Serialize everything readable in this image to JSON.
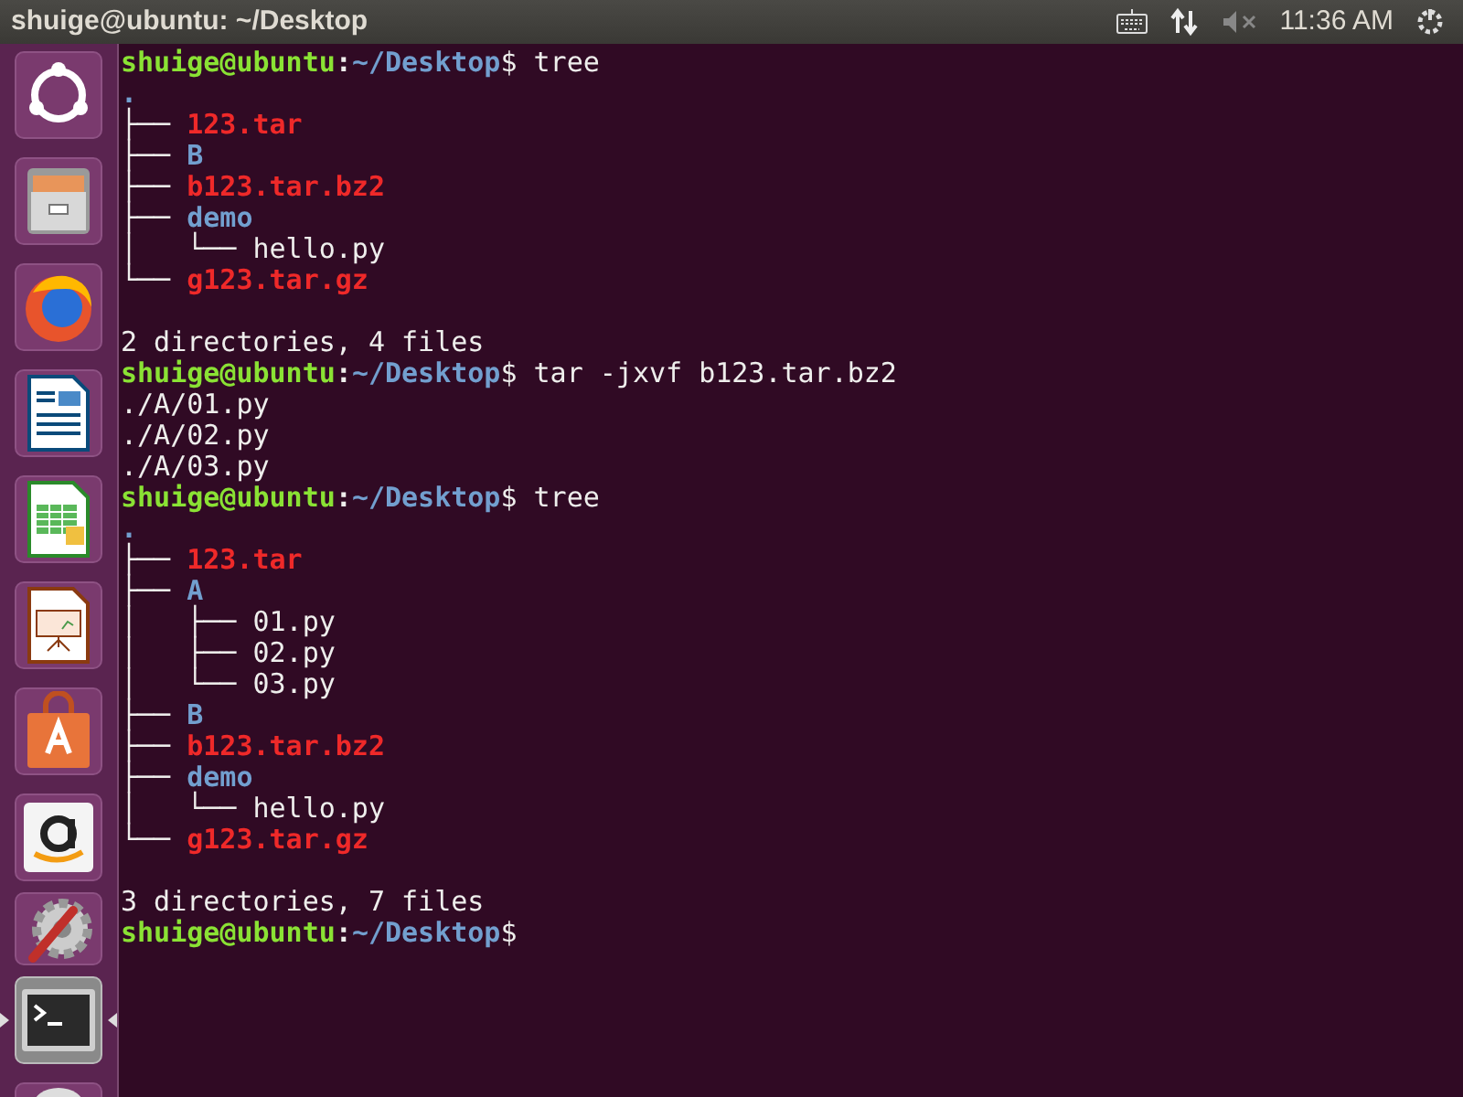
{
  "top_bar": {
    "title": "shuige@ubuntu: ~/Desktop",
    "clock": "11:36 AM"
  },
  "launcher": [
    {
      "kind": "ubuntu",
      "selected": false
    },
    {
      "kind": "files",
      "selected": false
    },
    {
      "kind": "browser",
      "selected": false
    },
    {
      "kind": "writer",
      "selected": false
    },
    {
      "kind": "calc",
      "selected": false
    },
    {
      "kind": "impress",
      "selected": false
    },
    {
      "kind": "store",
      "selected": false
    },
    {
      "kind": "amazon",
      "selected": false
    },
    {
      "kind": "settings",
      "selected": false
    },
    {
      "kind": "terminal",
      "selected": true
    },
    {
      "kind": "disc",
      "selected": false
    }
  ],
  "terminal": {
    "lines": [
      {
        "kind": "prompt",
        "user": "shuige@ubuntu",
        "sep": ":",
        "path": "~/Desktop",
        "symbol": "$",
        "command": " tree"
      },
      {
        "kind": "tree",
        "root": ".",
        "children": [
          {
            "prefix": "├── ",
            "name": "123.tar",
            "kind": "archive"
          },
          {
            "prefix": "├── ",
            "name": "B",
            "kind": "dir"
          },
          {
            "prefix": "├── ",
            "name": "b123.tar.bz2",
            "kind": "archive"
          },
          {
            "prefix": "├── ",
            "name": "demo",
            "kind": "dir",
            "children": [
              {
                "prefix": "│   └── ",
                "name": "hello.py",
                "kind": "file"
              }
            ]
          },
          {
            "prefix": "└── ",
            "name": "g123.tar.gz",
            "kind": "archive"
          }
        ]
      },
      {
        "kind": "blank"
      },
      {
        "kind": "text",
        "text": "2 directories, 4 files"
      },
      {
        "kind": "prompt",
        "user": "shuige@ubuntu",
        "sep": ":",
        "path": "~/Desktop",
        "symbol": "$",
        "command": " tar -jxvf b123.tar.bz2"
      },
      {
        "kind": "text",
        "text": "./A/01.py"
      },
      {
        "kind": "text",
        "text": "./A/02.py"
      },
      {
        "kind": "text",
        "text": "./A/03.py"
      },
      {
        "kind": "prompt",
        "user": "shuige@ubuntu",
        "sep": ":",
        "path": "~/Desktop",
        "symbol": "$",
        "command": " tree"
      },
      {
        "kind": "tree",
        "root": ".",
        "children": [
          {
            "prefix": "├── ",
            "name": "123.tar",
            "kind": "archive"
          },
          {
            "prefix": "├── ",
            "name": "A",
            "kind": "dir",
            "children": [
              {
                "prefix": "│   ├── ",
                "name": "01.py",
                "kind": "file"
              },
              {
                "prefix": "│   ├── ",
                "name": "02.py",
                "kind": "file"
              },
              {
                "prefix": "│   └── ",
                "name": "03.py",
                "kind": "file"
              }
            ]
          },
          {
            "prefix": "├── ",
            "name": "B",
            "kind": "dir"
          },
          {
            "prefix": "├── ",
            "name": "b123.tar.bz2",
            "kind": "archive"
          },
          {
            "prefix": "├── ",
            "name": "demo",
            "kind": "dir",
            "children": [
              {
                "prefix": "│   └── ",
                "name": "hello.py",
                "kind": "file"
              }
            ]
          },
          {
            "prefix": "└── ",
            "name": "g123.tar.gz",
            "kind": "archive"
          }
        ]
      },
      {
        "kind": "blank"
      },
      {
        "kind": "text",
        "text": "3 directories, 7 files"
      },
      {
        "kind": "prompt",
        "user": "shuige@ubuntu",
        "sep": ":",
        "path": "~/Desktop",
        "symbol": "$"
      }
    ]
  }
}
